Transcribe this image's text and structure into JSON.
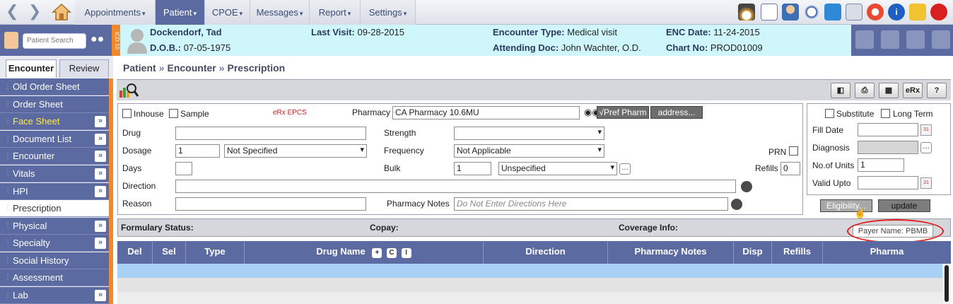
{
  "topnav": {
    "menus": [
      {
        "label": "Appointments"
      },
      {
        "label": "Patient"
      },
      {
        "label": "CPOE"
      },
      {
        "label": "Messages"
      },
      {
        "label": "Report"
      },
      {
        "label": "Settings"
      }
    ]
  },
  "patient_header": {
    "search_placeholder": "Patient Search",
    "icd_label": "ICD 10",
    "name": "Dockendorf, Tad",
    "dob_label": "D.O.B.:",
    "dob": "07-05-1975",
    "last_visit_label": "Last Visit:",
    "last_visit": "09-28-2015",
    "encounter_type_label": "Encounter Type:",
    "encounter_type": "Medical visit",
    "attending_label": "Attending Doc:",
    "attending": "John Wachter, O.D.",
    "enc_date_label": "ENC Date:",
    "enc_date": "11-24-2015",
    "chart_no_label": "Chart No:",
    "chart_no": "PROD01009"
  },
  "sidebar": {
    "tabs": [
      {
        "label": "Encounter"
      },
      {
        "label": "Review"
      }
    ],
    "items": [
      {
        "label": "Old Order Sheet"
      },
      {
        "label": "Order Sheet"
      },
      {
        "label": "Face Sheet"
      },
      {
        "label": "Document List"
      },
      {
        "label": "Encounter"
      },
      {
        "label": "Vitals"
      },
      {
        "label": "HPI"
      },
      {
        "label": "Prescription"
      },
      {
        "label": "Physical"
      },
      {
        "label": "Specialty"
      },
      {
        "label": "Social History"
      },
      {
        "label": "Assessment"
      },
      {
        "label": "Lab"
      }
    ]
  },
  "breadcrumb": {
    "items": [
      "Patient",
      "Encounter",
      "Prescription"
    ],
    "separator": "»"
  },
  "toolbar": {
    "erx_label": "eRx",
    "help_label": "?"
  },
  "form": {
    "inhouse_label": "Inhouse",
    "sample_label": "Sample",
    "erx_epcs": "eRx EPCS",
    "pharmacy_label": "Pharmacy",
    "pharmacy_value": "CA Pharmacy 10.6MU",
    "pref_pharm_label": "√Pref Pharm",
    "address_label": "address...",
    "drug_label": "Drug",
    "strength_label": "Strength",
    "dosage_label": "Dosage",
    "dosage_value": "1",
    "dosage_unit": "Not Specified",
    "frequency_label": "Frequency",
    "frequency_value": "Not Applicable",
    "prn_label": "PRN",
    "days_label": "Days",
    "bulk_label": "Bulk",
    "bulk_value": "1",
    "bulk_unit": "Unspecified",
    "refills_label": "Refills",
    "refills_value": "0",
    "direction_label": "Direction",
    "reason_label": "Reason",
    "pharmacy_notes_label": "Pharmacy Notes",
    "pharmacy_notes_placeholder": "Do Not Enter Directions Here"
  },
  "right_panel": {
    "substitute_label": "Substitute",
    "long_term_label": "Long Term",
    "fill_date_label": "Fill Date",
    "diagnosis_label": "Diagnosis",
    "units_label": "No.of Units",
    "units_value": "1",
    "valid_upto_label": "Valid Upto",
    "eligibility_label": "Eligibility...",
    "update_label": "update"
  },
  "formulary": {
    "status_label": "Formulary Status:",
    "copay_label": "Copay:",
    "coverage_label": "Coverage Info:"
  },
  "tooltip": {
    "text": "Payer Name: PBMB"
  },
  "table": {
    "columns": [
      {
        "label": "Del"
      },
      {
        "label": "Sel"
      },
      {
        "label": "Type"
      },
      {
        "label": "Drug Name"
      },
      {
        "label": "Direction"
      },
      {
        "label": "Pharmacy Notes"
      },
      {
        "label": "Disp"
      },
      {
        "label": "Refills"
      },
      {
        "label": "Pharma"
      }
    ],
    "drug_name_buttons": [
      "+",
      "C",
      "I"
    ]
  },
  "colors": {
    "nav": "#5b6aa1",
    "patient_bar": "#cff7fb",
    "accent_orange": "#f0892d",
    "highlight_row": "#a9d0f5",
    "ring": "#e21c1c"
  }
}
